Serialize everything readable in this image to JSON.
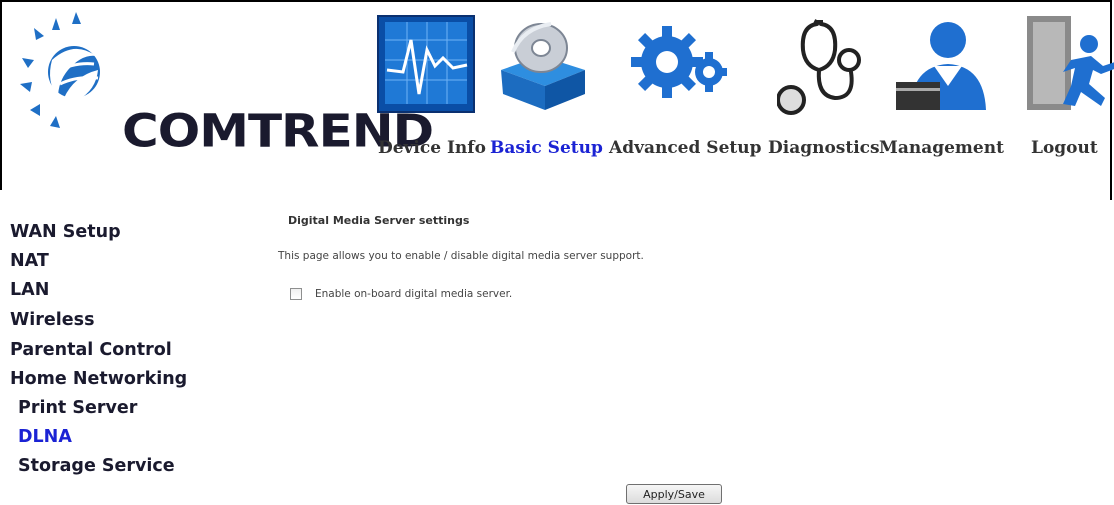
{
  "brand": {
    "name": "COMTREND",
    "colors": {
      "text": "#1a1a2e",
      "swirl": "#1f6fc5"
    }
  },
  "nav": {
    "items": [
      {
        "label": "Device Info",
        "icon": "device-info-icon",
        "active": false
      },
      {
        "label": "Basic Setup",
        "icon": "basic-setup-icon",
        "active": true
      },
      {
        "label": "Advanced Setup",
        "icon": "advanced-setup-icon",
        "active": false
      },
      {
        "label": "Diagnostics",
        "icon": "diagnostics-icon",
        "active": false
      },
      {
        "label": "Management",
        "icon": "management-icon",
        "active": false
      },
      {
        "label": "Logout",
        "icon": "logout-icon",
        "active": false
      }
    ],
    "active_color": "#1b23d4"
  },
  "sidebar": {
    "items": [
      {
        "label": "WAN Setup"
      },
      {
        "label": "NAT"
      },
      {
        "label": "LAN"
      },
      {
        "label": "Wireless"
      },
      {
        "label": "Parental Control"
      },
      {
        "label": "Home Networking"
      },
      {
        "label": "Print Server"
      },
      {
        "label": "DLNA",
        "active": true
      },
      {
        "label": "Storage Service"
      }
    ]
  },
  "main": {
    "title": "Digital Media Server settings",
    "description": "This page allows you to enable / disable digital media server support.",
    "checkbox_label": "Enable on-board digital media server.",
    "checkbox_checked": false,
    "apply_label": "Apply/Save"
  }
}
